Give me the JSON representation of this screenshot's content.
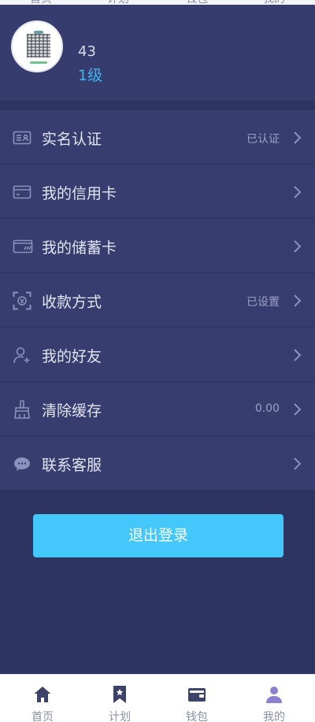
{
  "top_tabs": [
    "首页",
    "计划",
    "钱包",
    "我的"
  ],
  "profile": {
    "name": "43",
    "level": "1级"
  },
  "menu": [
    {
      "label": "实名认证",
      "value": "已认证",
      "icon": "id-card-icon"
    },
    {
      "label": "我的信用卡",
      "value": "",
      "icon": "credit-card-icon"
    },
    {
      "label": "我的储蓄卡",
      "value": "",
      "icon": "debit-card-icon"
    },
    {
      "label": "收款方式",
      "value": "已设置",
      "icon": "scan-payment-icon"
    },
    {
      "label": "我的好友",
      "value": "",
      "icon": "add-friend-icon"
    },
    {
      "label": "清除缓存",
      "value": "0.00",
      "icon": "broom-icon"
    },
    {
      "label": "联系客服",
      "value": "",
      "icon": "chat-bubble-icon"
    }
  ],
  "logout_label": "退出登录",
  "tabbar": {
    "items": [
      {
        "label": "首页",
        "icon": "home-icon"
      },
      {
        "label": "计划",
        "icon": "bookmark-star-icon"
      },
      {
        "label": "钱包",
        "icon": "wallet-icon"
      },
      {
        "label": "我的",
        "icon": "user-icon"
      }
    ],
    "active_index": 3
  },
  "colors": {
    "background": "#2e3462",
    "row": "#373d6e",
    "accent": "#44c7fb",
    "level": "#3fb6f0",
    "active_tab_icon": "#8a7fd0",
    "tab_icon": "#3c4268"
  }
}
